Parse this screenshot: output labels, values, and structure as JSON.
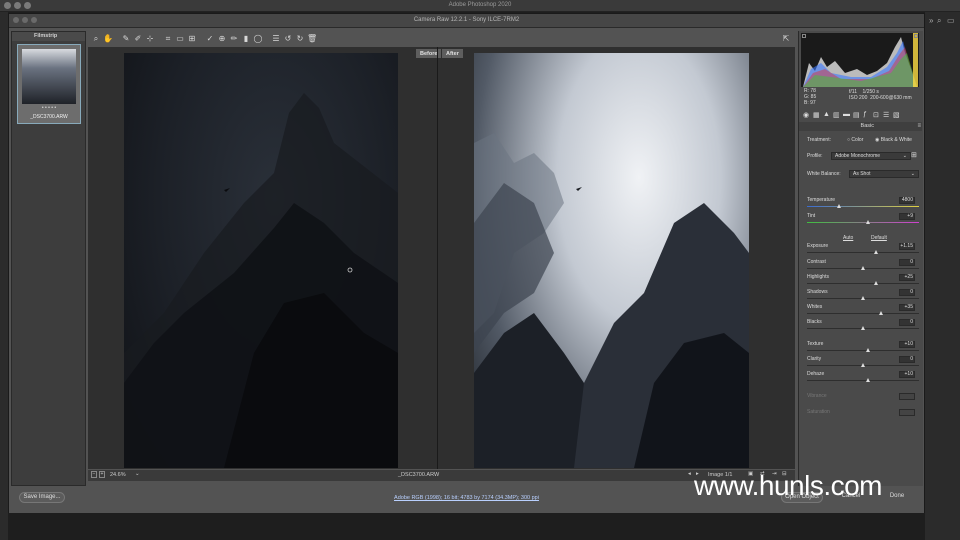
{
  "app": {
    "title": "Adobe Photoshop 2020",
    "dialog_title": "Camera Raw 12.2.1  -  Sony ILCE-7RM2"
  },
  "filmstrip": {
    "header": "Filmstrip",
    "thumb_stars": "• • • • •",
    "thumb_name": "_DSC3700.ARW"
  },
  "viewer": {
    "before_label": "Before",
    "after_label": "After"
  },
  "statusbar": {
    "zoom": "24.6%",
    "filename": "_DSC3700.ARW",
    "image_count": "Image 1/1"
  },
  "bottombar": {
    "save_label": "Save Image...",
    "workflow_link": "Adobe RGB (1998); 16 bit; 4783 by 7174 (34.3MP); 300 ppi",
    "open_label": "Open Object",
    "cancel_label": "Cancel",
    "done_label": "Done"
  },
  "watermark": "www.hunls.com",
  "info": {
    "r": "R:   78",
    "g": "G:   85",
    "b": "B:   97",
    "fstop": "f/11",
    "shutter": "1/250 s",
    "iso": "ISO 200",
    "lens": "200-600@630 mm"
  },
  "basic": {
    "title": "Basic",
    "treatment_label": "Treatment:",
    "treatment_color": "Color",
    "treatment_bw": "Black & White",
    "profile_label": "Profile:",
    "profile_value": "Adobe Monochrome",
    "wb_label": "White Balance:",
    "wb_value": "As Shot",
    "auto_label": "Auto",
    "default_label": "Default",
    "sliders": [
      {
        "label": "Temperature",
        "value": "4800",
        "pos": 0.28
      },
      {
        "label": "Tint",
        "value": "+9",
        "pos": 0.55
      },
      {
        "label": "Exposure",
        "value": "+1.15",
        "pos": 0.62
      },
      {
        "label": "Contrast",
        "value": "0",
        "pos": 0.5
      },
      {
        "label": "Highlights",
        "value": "+25",
        "pos": 0.62
      },
      {
        "label": "Shadows",
        "value": "0",
        "pos": 0.5
      },
      {
        "label": "Whites",
        "value": "+35",
        "pos": 0.67
      },
      {
        "label": "Blacks",
        "value": "0",
        "pos": 0.5
      },
      {
        "label": "Texture",
        "value": "+10",
        "pos": 0.55
      },
      {
        "label": "Clarity",
        "value": "0",
        "pos": 0.5
      },
      {
        "label": "Dehaze",
        "value": "+10",
        "pos": 0.55
      }
    ],
    "vibrance_label": "Vibrance",
    "saturation_label": "Saturation"
  },
  "colors": {
    "accent_link": "#b9d0ff",
    "temp_gradient_start": "#3a6bd0",
    "temp_gradient_end": "#e0d040",
    "tint_gradient_start": "#3fbf3f",
    "tint_gradient_end": "#d040d0"
  }
}
